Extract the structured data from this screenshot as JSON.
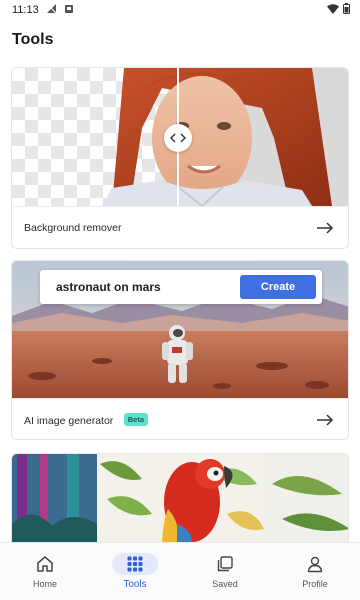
{
  "status_bar": {
    "time": "11:13"
  },
  "header": {
    "title": "Tools"
  },
  "cards": [
    {
      "label": "Background remover"
    },
    {
      "label": "AI image generator",
      "badge": "Beta",
      "prompt": "astronaut on mars",
      "button": "Create"
    },
    {
      "label": ""
    }
  ],
  "bottom_nav": {
    "items": [
      {
        "label": "Home",
        "icon": "home-icon"
      },
      {
        "label": "Tools",
        "icon": "grid-icon",
        "active": true
      },
      {
        "label": "Saved",
        "icon": "saved-icon"
      },
      {
        "label": "Profile",
        "icon": "profile-icon"
      }
    ]
  },
  "colors": {
    "accent": "#3f6fe0",
    "badge": "#5ce0d0",
    "active_nav_bg": "#e3e9fb"
  }
}
